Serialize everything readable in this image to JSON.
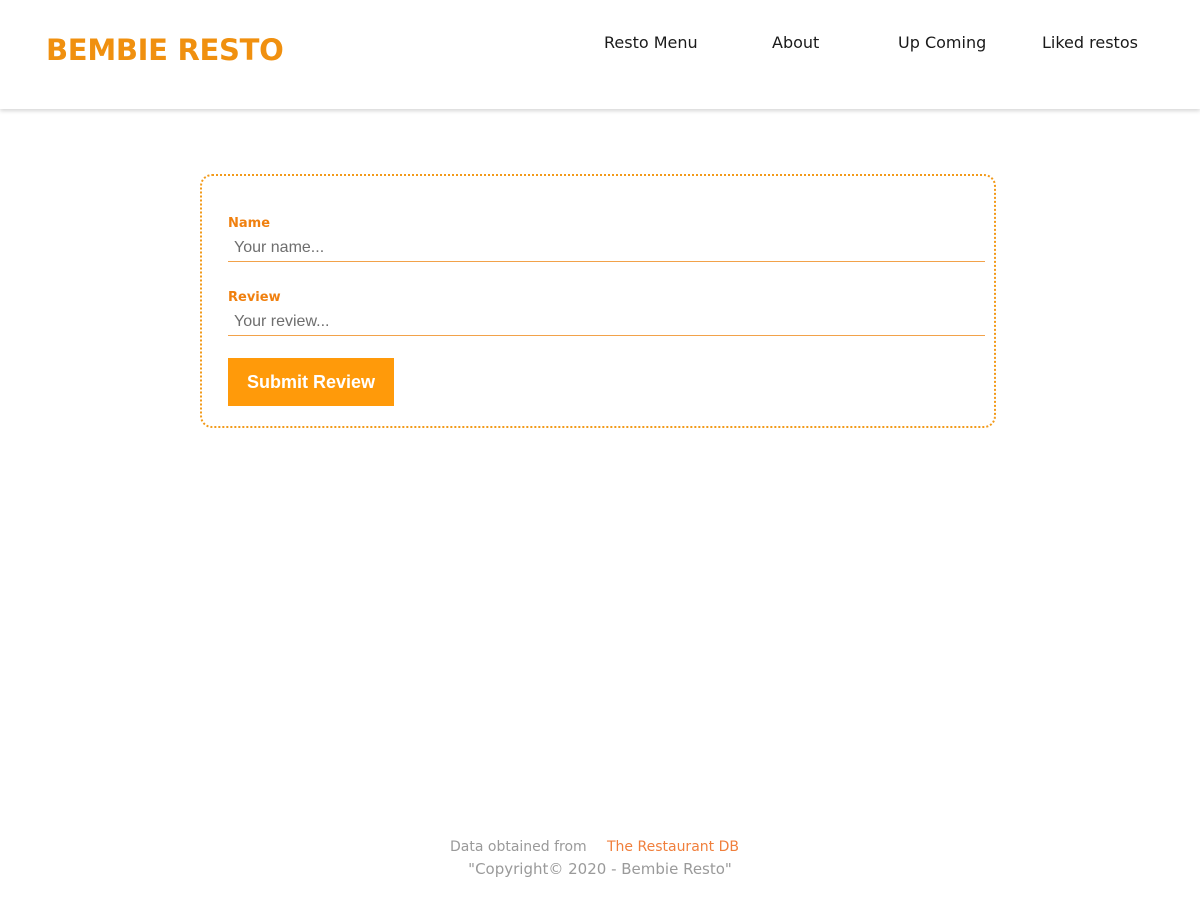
{
  "header": {
    "brand": "BEMBIE RESTO",
    "nav": [
      {
        "label": "Resto Menu"
      },
      {
        "label": "About"
      },
      {
        "label": "Up Coming"
      },
      {
        "label": "Liked restos"
      }
    ]
  },
  "review_form": {
    "name_label": "Name",
    "name_placeholder": "Your name...",
    "name_value": "",
    "review_label": "Review",
    "review_placeholder": "Your review...",
    "review_value": "",
    "submit_label": "Submit Review"
  },
  "footer": {
    "source_text": "Data obtained from",
    "source_link": "The Restaurant DB",
    "copyright": "\"Copyright© 2020 - Bembie Resto\""
  },
  "colors": {
    "accent": "#f0900f",
    "button": "#ff9a0a",
    "link": "#f07f3c",
    "muted_text": "#9a9a9a"
  }
}
